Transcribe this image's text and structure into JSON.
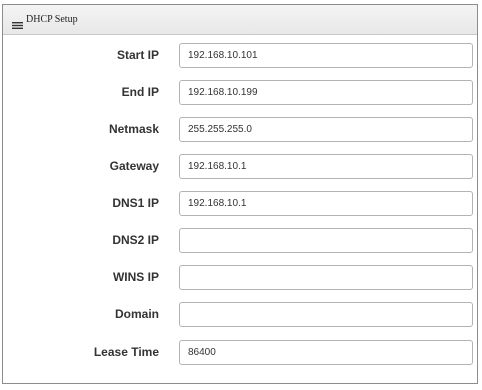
{
  "panel": {
    "title": "DHCP Setup",
    "icon": "list-icon"
  },
  "fields": [
    {
      "label": "Start IP",
      "value": "192.168.10.101"
    },
    {
      "label": "End IP",
      "value": "192.168.10.199"
    },
    {
      "label": "Netmask",
      "value": "255.255.255.0"
    },
    {
      "label": "Gateway",
      "value": "192.168.10.1"
    },
    {
      "label": "DNS1 IP",
      "value": "192.168.10.1"
    },
    {
      "label": "DNS2 IP",
      "value": ""
    },
    {
      "label": "WINS IP",
      "value": ""
    },
    {
      "label": "Domain",
      "value": ""
    },
    {
      "label": "Lease Time",
      "value": "86400"
    }
  ]
}
